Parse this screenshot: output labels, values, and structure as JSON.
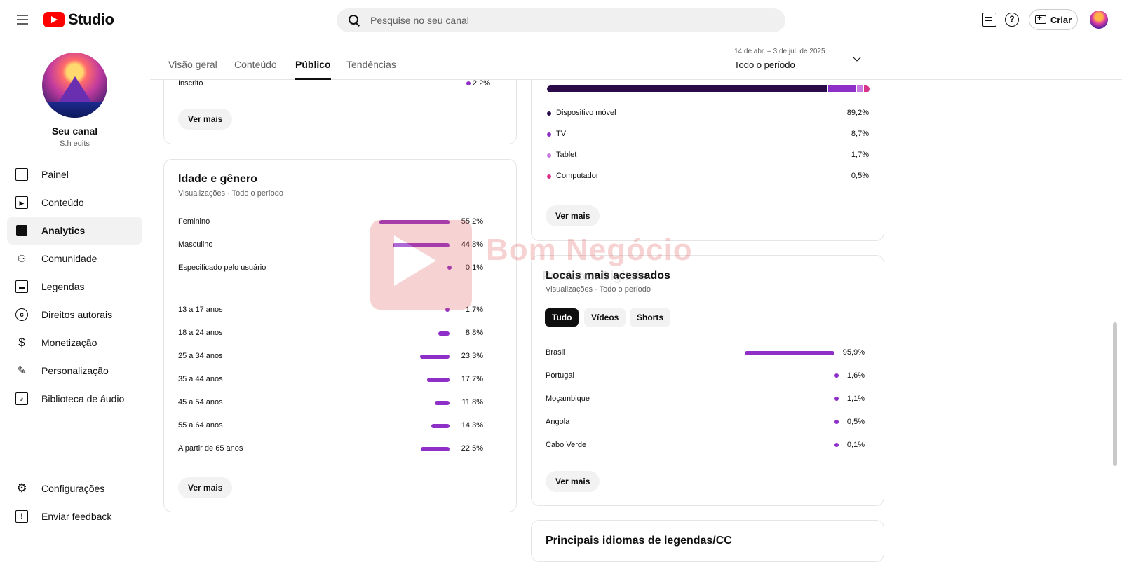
{
  "app": {
    "logo_text": "Studio"
  },
  "search": {
    "placeholder": "Pesquise no seu canal"
  },
  "header": {
    "create_label": "Criar",
    "help_glyph": "?"
  },
  "channel": {
    "name": "Seu canal",
    "handle": "S.h edits"
  },
  "sidebar": {
    "items": [
      {
        "label": "Painel",
        "icon": "dashboard-icon"
      },
      {
        "label": "Conteúdo",
        "icon": "content-icon"
      },
      {
        "label": "Analytics",
        "icon": "analytics-icon",
        "active": true
      },
      {
        "label": "Comunidade",
        "icon": "community-icon"
      },
      {
        "label": "Legendas",
        "icon": "subtitles-icon"
      },
      {
        "label": "Direitos autorais",
        "icon": "copyright-icon"
      },
      {
        "label": "Monetização",
        "icon": "dollar-icon"
      },
      {
        "label": "Personalização",
        "icon": "magic-wand-icon"
      },
      {
        "label": "Biblioteca de áudio",
        "icon": "audio-library-icon"
      }
    ],
    "bottom": [
      {
        "label": "Configurações",
        "icon": "gear-icon"
      },
      {
        "label": "Enviar feedback",
        "icon": "feedback-icon"
      }
    ]
  },
  "tabs": [
    "Visão geral",
    "Conteúdo",
    "Público",
    "Tendências"
  ],
  "active_tab": "Público",
  "period": {
    "range": "14 de abr. – 3 de jul. de 2025",
    "label": "Todo o período"
  },
  "top_card": {
    "row_label": "Inscrito",
    "row_value": "2,2%",
    "more": "Ver mais"
  },
  "age_gender": {
    "title": "Idade e gênero",
    "subtitle": "Visualizações · Todo o período",
    "gender": [
      {
        "label": "Feminino",
        "value": "55,2%",
        "pct": 55.2
      },
      {
        "label": "Masculino",
        "value": "44,8%",
        "pct": 44.8
      },
      {
        "label": "Especificado pelo usuário",
        "value": "0,1%",
        "pct": 0.1
      }
    ],
    "age": [
      {
        "label": "13 a 17 anos",
        "value": "1,7%",
        "pct": 1.7
      },
      {
        "label": "18 a 24 anos",
        "value": "8,8%",
        "pct": 8.8
      },
      {
        "label": "25 a 34 anos",
        "value": "23,3%",
        "pct": 23.3
      },
      {
        "label": "35 a 44 anos",
        "value": "17,7%",
        "pct": 17.7
      },
      {
        "label": "45 a 54 anos",
        "value": "11,8%",
        "pct": 11.8
      },
      {
        "label": "55 a 64 anos",
        "value": "14,3%",
        "pct": 14.3
      },
      {
        "label": "A partir de 65 anos",
        "value": "22,5%",
        "pct": 22.5
      }
    ],
    "more": "Ver mais"
  },
  "devices": {
    "items": [
      {
        "label": "Dispositivo móvel",
        "value": "89,2%",
        "pct": 89.2,
        "color": "#2b0a4a"
      },
      {
        "label": "TV",
        "value": "8,7%",
        "pct": 8.7,
        "color": "#8e2fc7"
      },
      {
        "label": "Tablet",
        "value": "1,7%",
        "pct": 1.7,
        "color": "#c77be0"
      },
      {
        "label": "Computador",
        "value": "0,5%",
        "pct": 0.5,
        "color": "#d6348a"
      }
    ],
    "more": "Ver mais"
  },
  "locations": {
    "title": "Locais mais acessados",
    "subtitle": "Visualizações · Todo o período",
    "chips": [
      "Tudo",
      "Vídeos",
      "Shorts"
    ],
    "active_chip": "Tudo",
    "items": [
      {
        "label": "Brasil",
        "value": "95,9%",
        "pct": 95.9
      },
      {
        "label": "Portugal",
        "value": "1,6%",
        "pct": 1.6
      },
      {
        "label": "Moçambique",
        "value": "1,1%",
        "pct": 1.1
      },
      {
        "label": "Angola",
        "value": "0,5%",
        "pct": 0.5
      },
      {
        "label": "Cabo Verde",
        "value": "0,1%",
        "pct": 0.1
      }
    ],
    "more": "Ver mais"
  },
  "languages": {
    "title": "Principais idiomas de legendas/CC"
  },
  "watermark": {
    "text": "Bom Negócio",
    "sub": "Produtos Digitais"
  },
  "colors": {
    "bar": "#8e2fc7",
    "accent": "#ff0000"
  }
}
